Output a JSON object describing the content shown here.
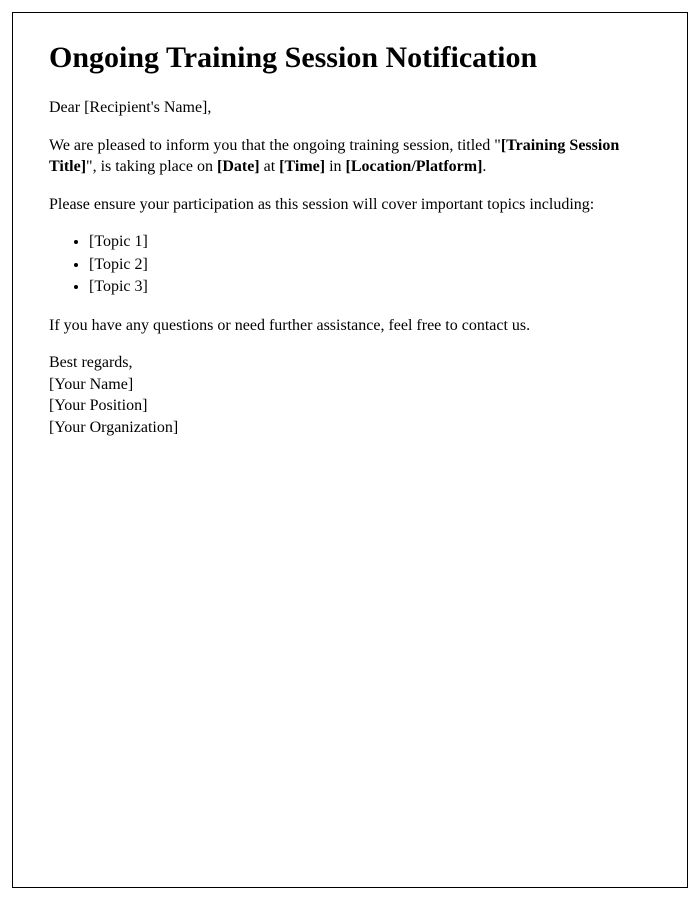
{
  "heading": "Ongoing Training Session Notification",
  "salutation_prefix": "Dear ",
  "recipient_name": "[Recipient's Name]",
  "salutation_suffix": ",",
  "intro_p1": "We are pleased to inform you that the ongoing training session, titled \"",
  "training_title": "[Training Session Title]",
  "intro_p2": "\", is taking place on ",
  "date_placeholder": "[Date]",
  "intro_p3": " at ",
  "time_placeholder": "[Time]",
  "intro_p4": " in ",
  "location_placeholder": "[Location/Platform]",
  "intro_p5": ".",
  "participation_line": "Please ensure your participation as this session will cover important topics including:",
  "topics": {
    "t1": "[Topic 1]",
    "t2": "[Topic 2]",
    "t3": "[Topic 3]"
  },
  "closing_line": "If you have any questions or need further assistance, feel free to contact us.",
  "signoff": "Best regards,",
  "your_name": "[Your Name]",
  "your_position": "[Your Position]",
  "your_organization": "[Your Organization]"
}
